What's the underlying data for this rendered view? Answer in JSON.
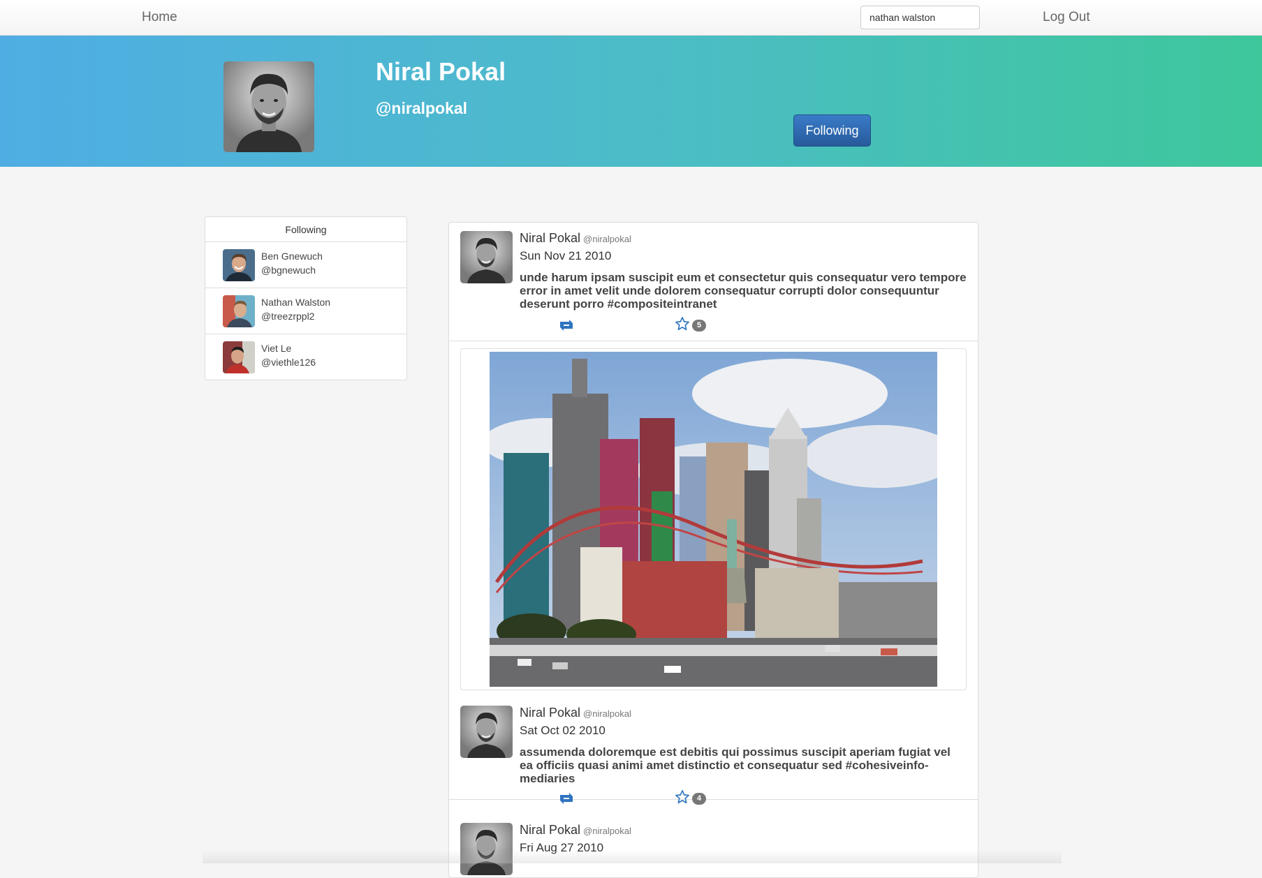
{
  "navbar": {
    "home_label": "Home",
    "search_value": "nathan walston",
    "logout_label": "Log Out"
  },
  "profile": {
    "name": "Niral Pokal",
    "handle": "@niralpokal",
    "follow_button_label": "Following"
  },
  "following_panel": {
    "title": "Following",
    "items": [
      {
        "name": "Ben Gnewuch",
        "handle": "@bgnewuch"
      },
      {
        "name": "Nathan Walston",
        "handle": "@treezrppl2"
      },
      {
        "name": "Viet Le",
        "handle": "@viethle126"
      }
    ]
  },
  "feed": {
    "tweets": [
      {
        "name": "Niral Pokal",
        "handle": "@niralpokal",
        "date": "Sun Nov 21 2010",
        "text": "unde harum ipsam suscipit eum et consectetur quis consequatur vero tempore error in amet velit unde dolorem consequatur corrupti dolor consequuntur deserunt porro #compositeintranet",
        "star_count": "5"
      },
      {
        "name": "Niral Pokal",
        "handle": "@niralpokal",
        "date": "Sat Oct 02 2010",
        "text": "assumenda doloremque est debitis qui possimus suscipit aperiam fugiat vel ea officiis quasi animi amet distinctio et consequatur sed #cohesiveinfo-mediaries",
        "star_count": "4"
      },
      {
        "name": "Niral Pokal",
        "handle": "@niralpokal",
        "date": "Fri Aug 27 2010"
      }
    ]
  },
  "colors": {
    "accent_blue": "#2f74c0",
    "hero_start": "#4fade3",
    "hero_end": "#3ec79b",
    "badge_gray": "#777777"
  }
}
